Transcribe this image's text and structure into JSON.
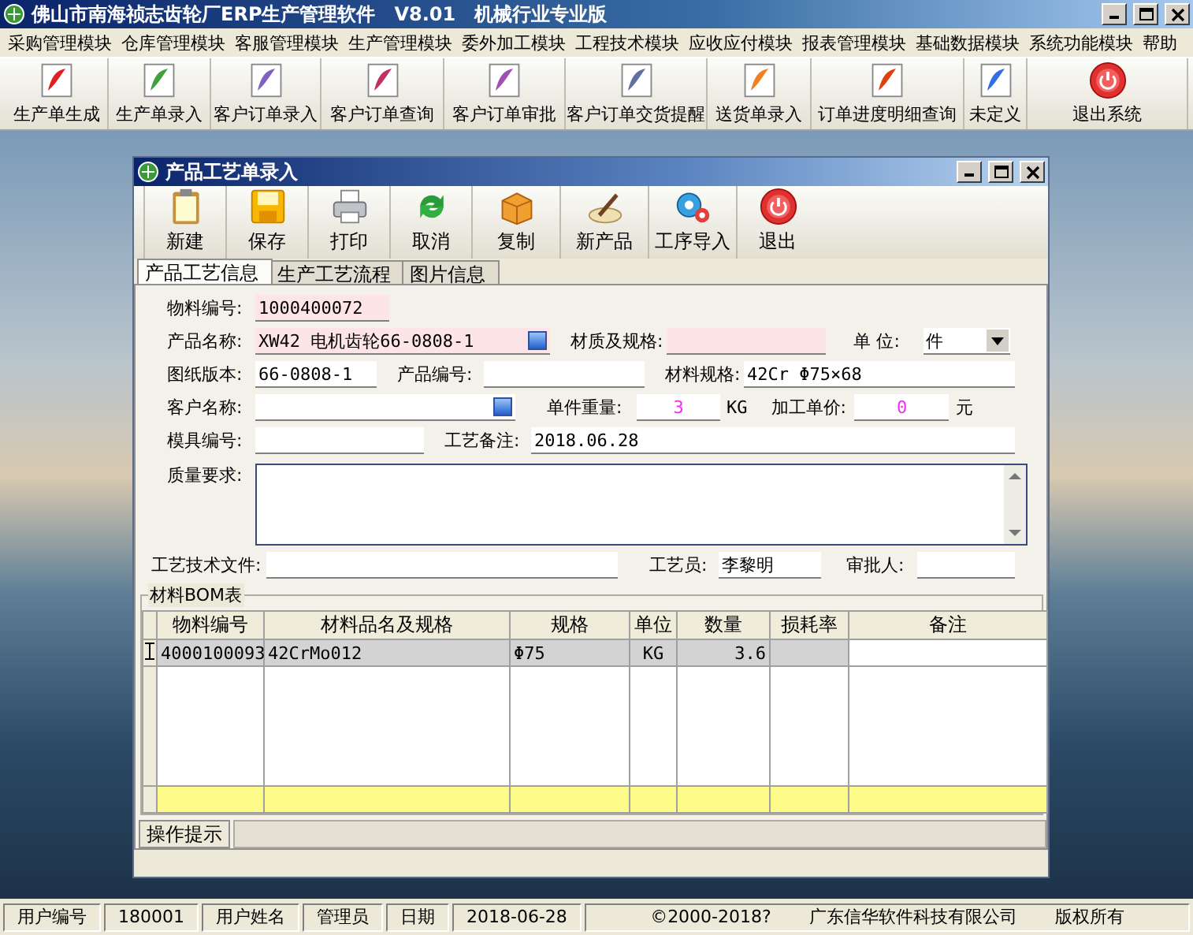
{
  "window": {
    "title": "佛山市南海祯志齿轮厂ERP生产管理软件　V8.01　机械行业专业版"
  },
  "menu": [
    "采购管理模块",
    "仓库管理模块",
    "客服管理模块",
    "生产管理模块",
    "委外加工模块",
    "工程技术模块",
    "应收应付模块",
    "报表管理模块",
    "基础数据模块",
    "系统功能模块",
    "帮助"
  ],
  "toolbar": [
    {
      "label": "生产单生成",
      "kind": "document"
    },
    {
      "label": "生产单录入",
      "kind": "document"
    },
    {
      "label": "客户订单录入",
      "kind": "document"
    },
    {
      "label": "客户订单查询",
      "kind": "document"
    },
    {
      "label": "客户订单审批",
      "kind": "document"
    },
    {
      "label": "客户订单交货提醒",
      "kind": "document"
    },
    {
      "label": "送货单录入",
      "kind": "document"
    },
    {
      "label": "订单进度明细查询",
      "kind": "document"
    },
    {
      "label": "未定义",
      "kind": "document"
    },
    {
      "label": "退出系统",
      "kind": "exit"
    }
  ],
  "child_window": {
    "title": "产品工艺单录入",
    "toolbar": [
      "新建",
      "保存",
      "打印",
      "取消",
      "复制",
      "新产品",
      "工序导入",
      "退出"
    ],
    "tabs": [
      {
        "label": "产品工艺信息",
        "selected": true
      },
      {
        "label": "生产工艺流程",
        "selected": false
      },
      {
        "label": "图片信息",
        "selected": false
      }
    ],
    "form": [
      [
        {
          "label": "物料编号:",
          "value": "1000400072",
          "kind": "text",
          "required": true
        }
      ],
      [
        {
          "label": "产品名称:",
          "value": "XW42 电机齿轮66-0808-1",
          "kind": "lookup",
          "required": true
        },
        {
          "label": "材质及规格:",
          "kind": "text",
          "required": true
        },
        {
          "label": "单 位:",
          "value": "件",
          "kind": "select",
          "required": false
        }
      ],
      [
        {
          "label": "图纸版本:",
          "value": "66-0808-1",
          "kind": "text",
          "required": false
        },
        {
          "label": "产品编号:",
          "kind": "text",
          "required": false
        },
        {
          "label": "材料规格:",
          "value": "42Cr Φ75×68",
          "kind": "text",
          "required": false
        }
      ],
      [
        {
          "label": "客户名称:",
          "kind": "lookup",
          "required": false
        },
        {
          "label": "单件重量:",
          "value": "3",
          "kind": "number",
          "unit": "KG",
          "required": false
        },
        {
          "label": "加工单价:",
          "value": "0",
          "kind": "number",
          "unit": "元",
          "required": false
        }
      ],
      [
        {
          "label": "模具编号:",
          "kind": "text",
          "required": false
        },
        {
          "label": "工艺备注:",
          "value": "2018.06.28",
          "kind": "text",
          "required": false
        }
      ],
      [
        {
          "label": "质量要求:",
          "kind": "memo",
          "required": false
        }
      ],
      [
        {
          "label": "工艺技术文件:",
          "kind": "text",
          "required": false
        },
        {
          "label": "工艺员:",
          "value": "李黎明",
          "kind": "text",
          "required": false
        },
        {
          "label": "审批人:",
          "kind": "text",
          "required": false
        }
      ]
    ],
    "bom": {
      "title": "材料BOM表",
      "columns": [
        "物料编号",
        "材料品名及规格",
        "规格",
        "单位",
        "数量",
        "损耗率",
        "备注"
      ],
      "rows": [
        {
          "selected": true,
          "cells": [
            "4000100093",
            "42CrMo012",
            "Φ75",
            "KG",
            "3.6",
            "",
            ""
          ]
        }
      ]
    },
    "hint_tab": "操作提示"
  },
  "status_bar": {
    "cells": [
      "用户编号",
      "180001",
      "用户姓名",
      "管理员",
      "日期",
      "2018-06-28"
    ],
    "copyright": [
      "©2000-2018?",
      "广东信华软件科技有限公司",
      "版权所有"
    ]
  }
}
